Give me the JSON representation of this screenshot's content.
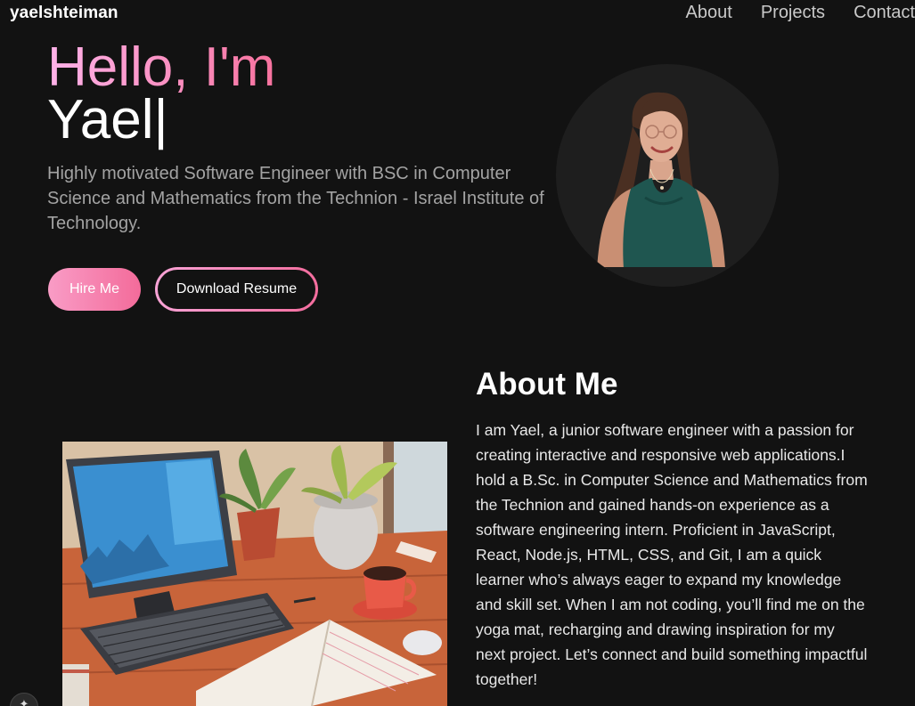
{
  "nav": {
    "brand": "yaelshteiman",
    "links": [
      "About",
      "Projects",
      "Contact"
    ]
  },
  "hero": {
    "greeting": "Hello, I'm",
    "name": "Yael|",
    "description": "Highly motivated Software Engineer with BSC in Computer Science and Mathematics from the Technion - Israel Institute of Technology.",
    "hire_label": "Hire Me",
    "resume_label": "Download Resume"
  },
  "about": {
    "title": "About Me",
    "text": "I am Yael, a junior software engineer with a passion for creating interactive and responsive web applications.I hold a B.Sc. in Computer Science and Mathematics from the Technion and gained hands-on experience as a software engineering intern. Proficient in JavaScript, React, Node.js, HTML, CSS, and Git, I am a quick learner who’s always eager to expand my knowledge and skill set. When I am not coding, you’ll find me on the yoga mat, recharging and drawing inspiration for my next project. Let’s connect and build something impactful together!"
  },
  "colors": {
    "background": "#121212",
    "accent_start": "#ffb3ea",
    "accent_end": "#f36b9a",
    "muted_text": "#a3a3a3"
  },
  "icons": {
    "corner_widget": "sparkle-icon"
  }
}
